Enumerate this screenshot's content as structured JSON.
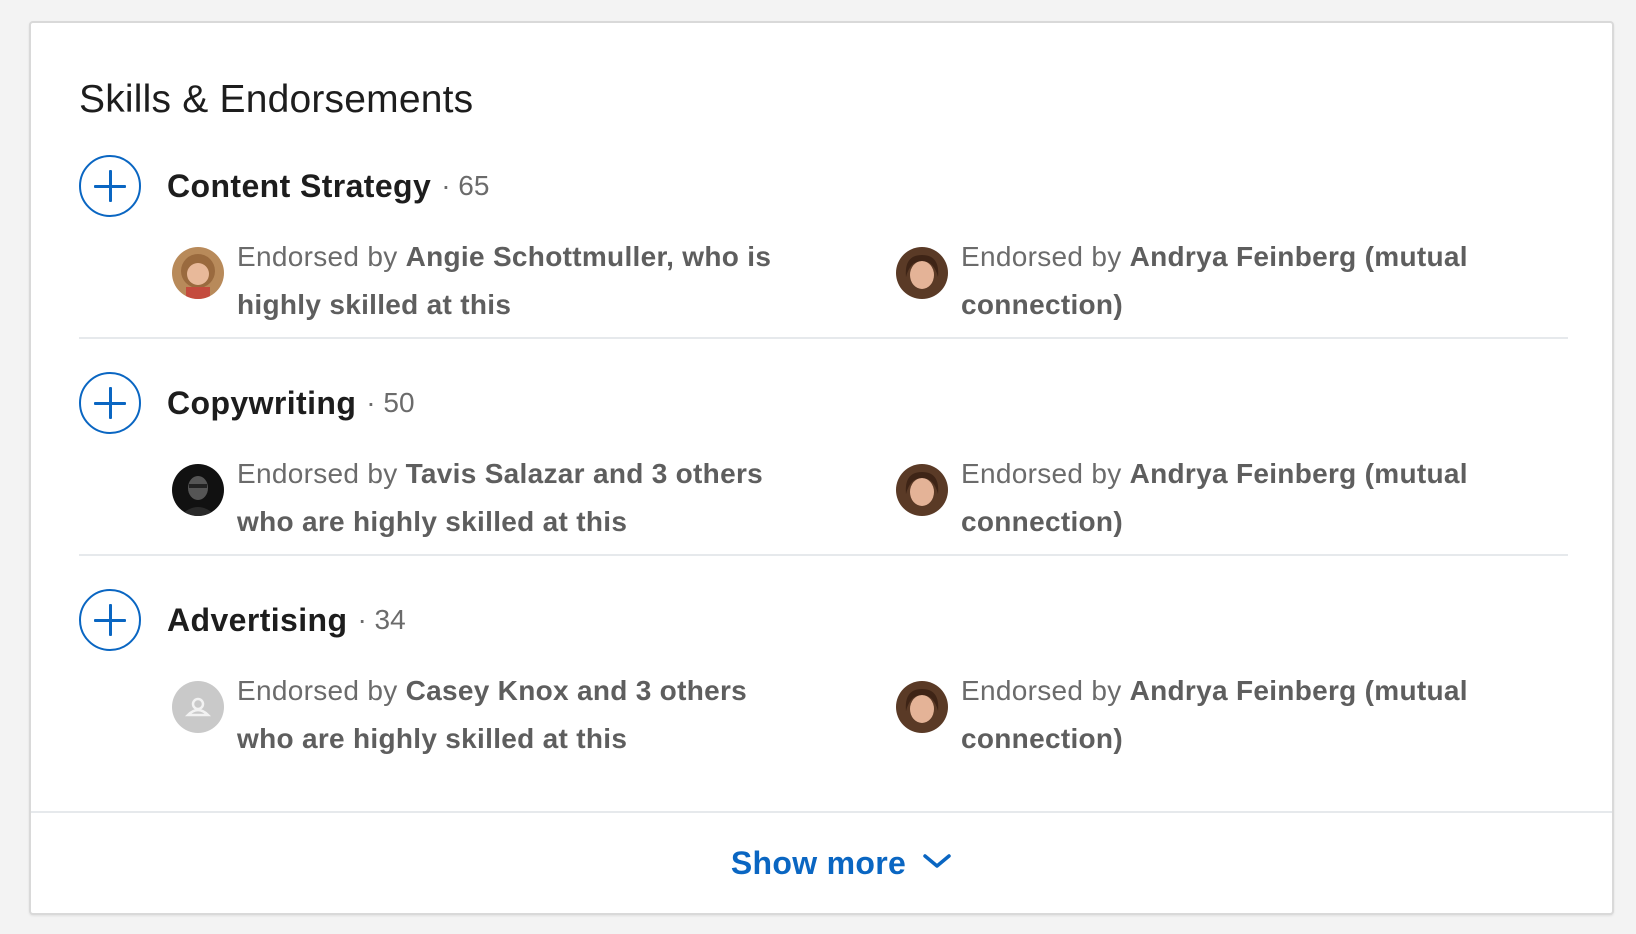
{
  "section": {
    "title": "Skills & Endorsements"
  },
  "skills": [
    {
      "name": "Content Strategy",
      "count": "· 65",
      "endorsements": [
        {
          "prefix": "Endorsed by ",
          "highlight": "Angie Schottmuller, who is highly skilled at this",
          "avatar": "woman-curly-hair-avatar"
        },
        {
          "prefix": "Endorsed by ",
          "highlight": "Andrya Feinberg (mutual connection)",
          "avatar": "woman-brown-hair-avatar"
        }
      ]
    },
    {
      "name": "Copywriting",
      "count": "· 50",
      "endorsements": [
        {
          "prefix": "Endorsed by ",
          "highlight": "Tavis Salazar and 3 others who are highly skilled at this",
          "avatar": "man-dark-photo-avatar"
        },
        {
          "prefix": "Endorsed by ",
          "highlight": "Andrya Feinberg (mutual connection)",
          "avatar": "woman-brown-hair-avatar"
        }
      ]
    },
    {
      "name": "Advertising",
      "count": "· 34",
      "endorsements": [
        {
          "prefix": "Endorsed by ",
          "highlight": "Casey Knox and 3 others who are highly skilled at this",
          "avatar": "default-person-avatar"
        },
        {
          "prefix": "Endorsed by ",
          "highlight": "Andrya Feinberg (mutual connection)",
          "avatar": "woman-brown-hair-avatar"
        }
      ]
    }
  ],
  "footer": {
    "show_more_label": "Show more",
    "icon": "chevron-down-icon"
  },
  "colors": {
    "accent": "#0a66c2",
    "muted_text": "#6b6b6b",
    "divider": "#e6e9ec"
  }
}
